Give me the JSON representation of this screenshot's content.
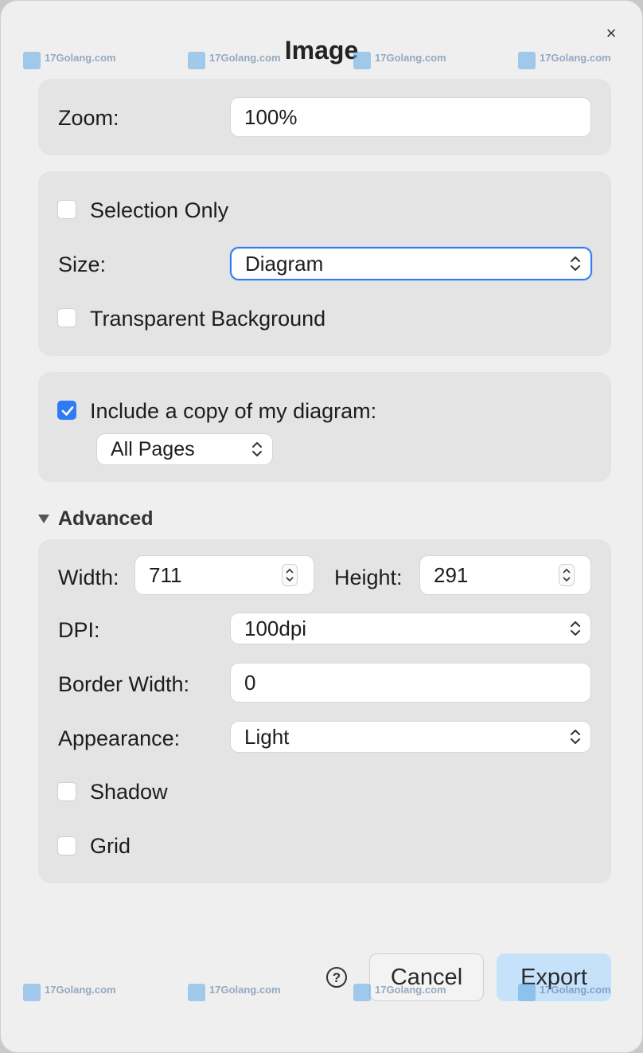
{
  "dialog": {
    "title": "Image",
    "close_icon": "×"
  },
  "zoom": {
    "label": "Zoom:",
    "value": "100%"
  },
  "options": {
    "selection_only": {
      "label": "Selection Only",
      "checked": false
    },
    "size": {
      "label": "Size:",
      "value": "Diagram"
    },
    "transparent_background": {
      "label": "Transparent Background",
      "checked": false
    }
  },
  "copy": {
    "include_label": "Include a copy of my diagram:",
    "checked": true,
    "pages_value": "All Pages"
  },
  "advanced": {
    "heading": "Advanced",
    "width_label": "Width:",
    "width_value": "711",
    "height_label": "Height:",
    "height_value": "291",
    "dpi_label": "DPI:",
    "dpi_value": "100dpi",
    "border_width_label": "Border Width:",
    "border_width_value": "0",
    "appearance_label": "Appearance:",
    "appearance_value": "Light",
    "shadow_label": "Shadow",
    "shadow_checked": false,
    "grid_label": "Grid",
    "grid_checked": false
  },
  "footer": {
    "help_icon": "?",
    "cancel_label": "Cancel",
    "export_label": "Export"
  },
  "watermark": {
    "text": "17Golang.com"
  },
  "colors": {
    "accent": "#2f7bf5",
    "export_bg": "#c6e2fb",
    "panel_bg": "#e4e4e4"
  }
}
